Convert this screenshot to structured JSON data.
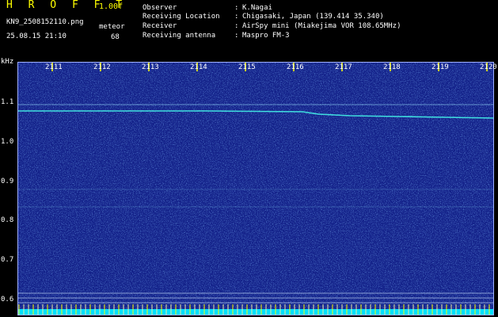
{
  "header": {
    "app_title": "H R O F F T",
    "version": "1.00f",
    "filename": "KN9_2508152110.png",
    "meteor_label": "meteor",
    "datetime": "25.08.15 21:10",
    "meteor_count": "68",
    "info": [
      {
        "key": "Observer",
        "value": "K.Nagai"
      },
      {
        "key": "Receiving Location",
        "value": "Chigasaki, Japan (139.414 35.340)"
      },
      {
        "key": "Receiver",
        "value": "AirSpy mini (Miakejima VOR 108.65MHz)"
      },
      {
        "key": "Receiving antenna",
        "value": "Maspro FM-3"
      }
    ]
  },
  "axis": {
    "y_unit": "kHz",
    "y_ticks": [
      "1.1",
      "1.0",
      "0.9",
      "0.8",
      "0.7",
      "0.6"
    ],
    "x_ticks": [
      "2111",
      "2112",
      "2113",
      "2114",
      "2115",
      "2116",
      "2117",
      "2118",
      "2119",
      "2120"
    ]
  },
  "colors": {
    "background": "#000000",
    "spectrogram": "#1a2f9e",
    "accent": "#ffff00",
    "signal": "#40e0e0"
  }
}
